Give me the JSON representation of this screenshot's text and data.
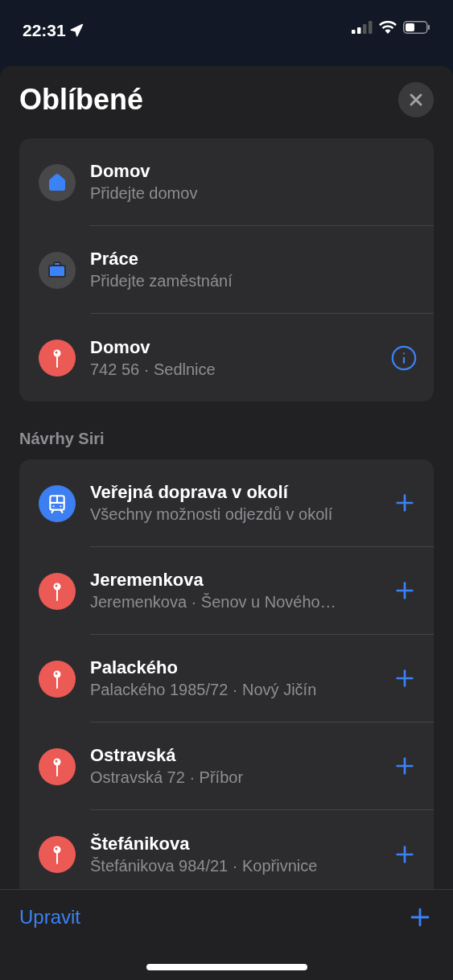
{
  "status_bar": {
    "time": "22:31"
  },
  "sheet": {
    "title": "Oblíbené"
  },
  "favorites": [
    {
      "kind": "home",
      "title": "Domov",
      "subtitle": "Přidejte domov",
      "info": false
    },
    {
      "kind": "work",
      "title": "Práce",
      "subtitle": "Přidejte zaměstnání",
      "info": false
    },
    {
      "kind": "pin",
      "title": "Domov",
      "subtitle": "742 56 · Sedlnice",
      "info": true
    }
  ],
  "suggestions_header": "Návrhy Siri",
  "suggestions": [
    {
      "kind": "transit",
      "title": "Veřejná doprava v okolí",
      "subtitle": "Všechny možnosti odjezdů v okolí"
    },
    {
      "kind": "pin",
      "title": "Jeremenkova",
      "subtitle": "Jeremenkova · Šenov u Nového…"
    },
    {
      "kind": "pin",
      "title": "Palackého",
      "subtitle": "Palackého 1985/72 · Nový Jičín"
    },
    {
      "kind": "pin",
      "title": "Ostravská",
      "subtitle": "Ostravská 72 · Příbor"
    },
    {
      "kind": "pin",
      "title": "Štefánikova",
      "subtitle": "Štefánikova 984/21 · Kopřivnice"
    }
  ],
  "toolbar": {
    "edit": "Upravit"
  }
}
